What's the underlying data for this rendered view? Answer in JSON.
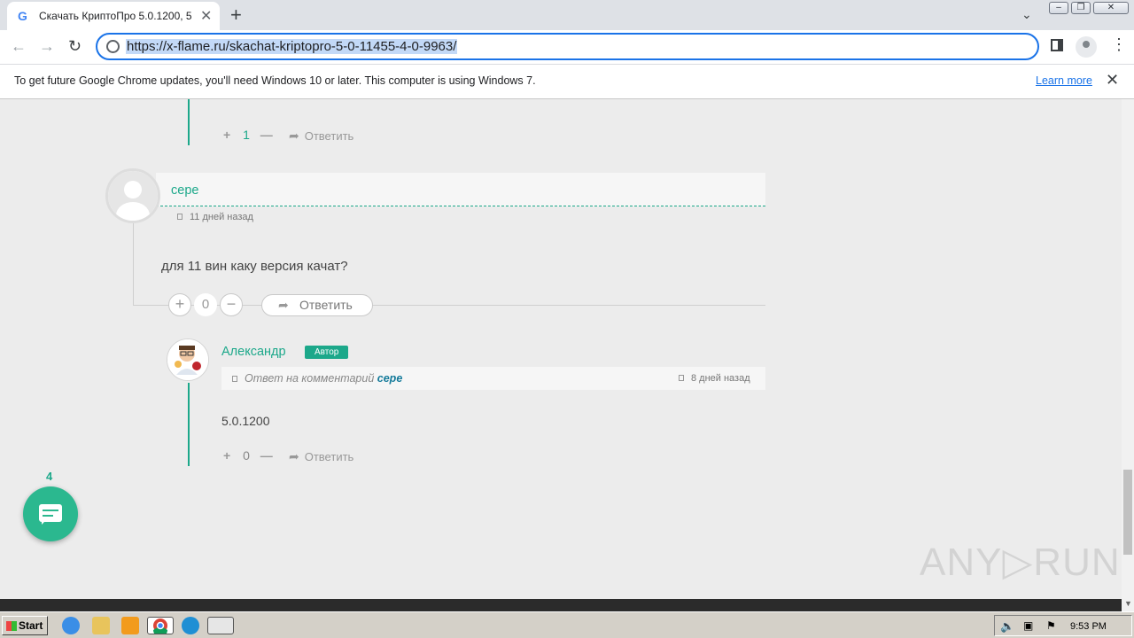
{
  "browser": {
    "tab_title": "Скачать КриптоПро 5.0.1200, 5.0",
    "url": "https://x-flame.ru/skachat-kriptopro-5-0-11455-4-0-9963/",
    "infobar_message": "To get future Google Chrome updates, you'll need Windows 10 or later. This computer is using Windows 7.",
    "infobar_link": "Learn more"
  },
  "comments": {
    "prev_reply": {
      "vote_count": "1",
      "reply_label": "Ответить"
    },
    "comment1": {
      "author": "сере",
      "time": "11 дней назад",
      "text": "для 11 вин каку версия качат?",
      "vote_count": "0",
      "reply_label": "Ответить"
    },
    "reply1": {
      "author": "Александр",
      "badge": "Автор",
      "reply_to_prefix": "Ответ на комментарий",
      "reply_to_name": "сере",
      "time": "8 дней назад",
      "text": "5.0.1200",
      "vote_count": "0",
      "reply_label": "Ответить"
    }
  },
  "chat": {
    "count": "4"
  },
  "watermark": "ANY▷RUN",
  "taskbar": {
    "start_label": "Start",
    "clock": "9:53 PM"
  },
  "colors": {
    "accent": "#1ca88a",
    "chat_button": "#2bb88f",
    "omnibox_border": "#1a73e8"
  }
}
